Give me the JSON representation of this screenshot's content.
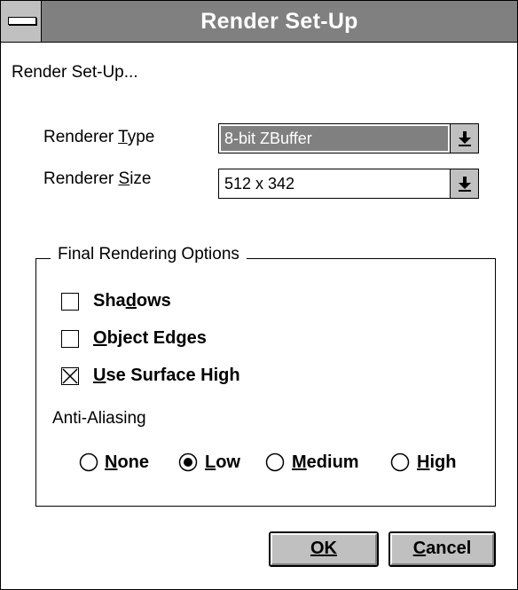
{
  "window": {
    "title": "Render Set-Up"
  },
  "heading": "Render Set-Up...",
  "renderer_type": {
    "label": "Renderer Type",
    "value": "8-bit ZBuffer"
  },
  "renderer_size": {
    "label": "Renderer Size",
    "value": "512 x 342"
  },
  "final_options": {
    "label": "Final Rendering Options",
    "shadows": {
      "label": "Shadows",
      "checked": false
    },
    "object_edges": {
      "label": "Object Edges",
      "checked": false
    },
    "use_surface_high": {
      "label": "Use Surface High",
      "checked": true
    },
    "anti_aliasing": {
      "label": "Anti-Aliasing",
      "options": [
        "None",
        "Low",
        "Medium",
        "High"
      ],
      "selected": "Low"
    }
  },
  "buttons": {
    "ok": "OK",
    "cancel": "Cancel"
  }
}
